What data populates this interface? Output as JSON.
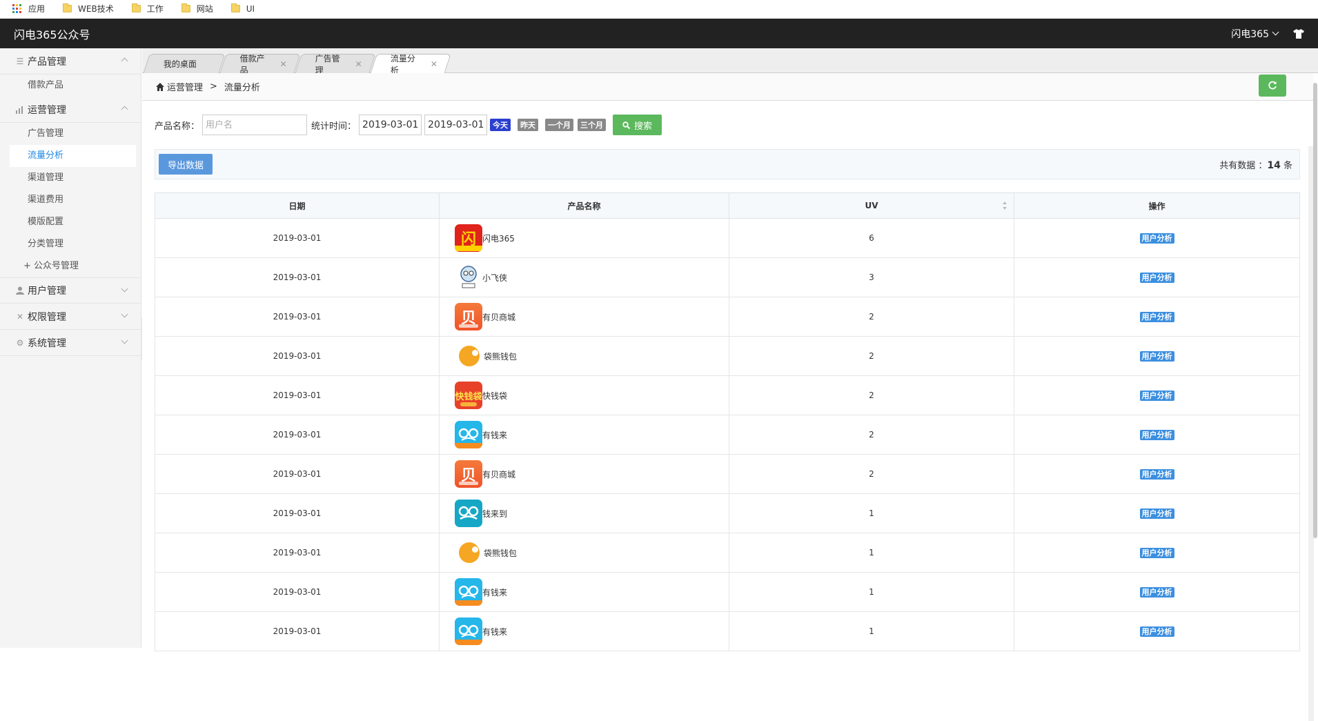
{
  "bookmarks": [
    {
      "label": "应用",
      "icon": "apps-icon"
    },
    {
      "label": "WEB技术",
      "icon": "folder-icon"
    },
    {
      "label": "工作",
      "icon": "folder-icon"
    },
    {
      "label": "网站",
      "icon": "folder-icon"
    },
    {
      "label": "UI",
      "icon": "folder-icon"
    }
  ],
  "header": {
    "brand": "闪电365公众号",
    "user": "闪电365"
  },
  "sidebar": {
    "groups": [
      {
        "label": "产品管理",
        "icon": "list-icon",
        "items": [
          "借款产品"
        ]
      },
      {
        "label": "运营管理",
        "icon": "chart-icon",
        "items": [
          "广告管理",
          "流量分析",
          "渠道管理",
          "渠道费用",
          "模版配置",
          "分类管理",
          "+ 公众号管理"
        ]
      },
      {
        "label": "用户管理",
        "icon": "user-icon"
      },
      {
        "label": "权限管理",
        "icon": "tools-icon"
      },
      {
        "label": "系统管理",
        "icon": "gear-icon"
      }
    ]
  },
  "tabs": [
    "我的桌面",
    "借款产品",
    "广告管理",
    "流量分析"
  ],
  "breadcrumb": {
    "parent": "运营管理",
    "sep": ">",
    "current": "流量分析"
  },
  "filters": {
    "product_label": "产品名称：",
    "product_placeholder": "用户名",
    "time_label": "统计时间：",
    "date_start": "2019-03-01",
    "date_end": "2019-03-01",
    "quick": [
      "今天",
      "昨天",
      "一个月",
      "三个月"
    ],
    "search": "搜索"
  },
  "toolbar": {
    "export": "导出数据",
    "total_prefix": "共有数据 ：",
    "total_count": "14",
    "total_suffix": " 条"
  },
  "table": {
    "columns": [
      "日期",
      "产品名称",
      "UV",
      "操作"
    ],
    "action_label": "用户分析",
    "rows": [
      {
        "date": "2019-03-01",
        "product": "闪电365",
        "uv": "6",
        "logo": "shandian"
      },
      {
        "date": "2019-03-01",
        "product": "小飞侠",
        "uv": "3",
        "logo": "xiaofeixia"
      },
      {
        "date": "2019-03-01",
        "product": "有贝商城",
        "uv": "2",
        "logo": "youbei"
      },
      {
        "date": "2019-03-01",
        "product": "袋熊钱包",
        "uv": "2",
        "logo": "daixiong"
      },
      {
        "date": "2019-03-01",
        "product": "快钱袋",
        "uv": "2",
        "logo": "kuaiqian"
      },
      {
        "date": "2019-03-01",
        "product": "有钱来",
        "uv": "2",
        "logo": "youqianlai"
      },
      {
        "date": "2019-03-01",
        "product": "有贝商城",
        "uv": "2",
        "logo": "youbei"
      },
      {
        "date": "2019-03-01",
        "product": "钱来到",
        "uv": "1",
        "logo": "qianlaidao"
      },
      {
        "date": "2019-03-01",
        "product": "袋熊钱包",
        "uv": "1",
        "logo": "daixiong"
      },
      {
        "date": "2019-03-01",
        "product": "有钱来",
        "uv": "1",
        "logo": "youqianlai"
      },
      {
        "date": "2019-03-01",
        "product": "有钱来",
        "uv": "1",
        "logo": "youqianlai"
      }
    ]
  }
}
